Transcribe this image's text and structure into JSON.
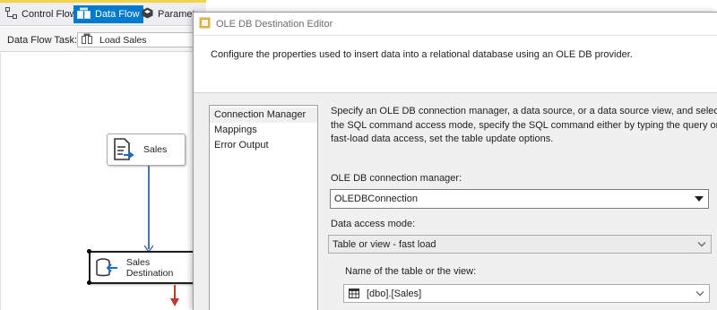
{
  "designer": {
    "tabs": [
      {
        "label": "Control Flow"
      },
      {
        "label": "Data Flow"
      },
      {
        "label": "Paramete"
      }
    ],
    "task_label": "Data Flow Task:",
    "task_value": "Load Sales",
    "components": [
      {
        "label": "Sales"
      },
      {
        "label": "Sales Destination"
      }
    ]
  },
  "dialog": {
    "title": "OLE DB Destination Editor",
    "description": "Configure the properties used to insert data into a relational database using an OLE DB provider.",
    "nav_items": [
      {
        "label": "Connection Manager"
      },
      {
        "label": "Mappings"
      },
      {
        "label": "Error Output"
      }
    ],
    "info_lines": [
      "Specify an OLE DB connection manager, a data source, or a data source view, and select the dat",
      "the SQL command access mode, specify the SQL command either by typing the query or by us",
      "fast-load data access, set the table update options."
    ],
    "connection_label": "OLE DB connection manager:",
    "connection_value": "OLEDBConnection",
    "access_mode_label": "Data access mode:",
    "access_mode_value": "Table or view - fast load",
    "table_label": "Name of the table or the view:",
    "table_value": "[dbo].[Sales]"
  },
  "colors": {
    "accent": "#007acc",
    "flow_line": "#4f6fa8",
    "error_arrow": "#c0392b"
  },
  "icons": [
    "control-flow-icon",
    "data-flow-icon",
    "parameters-icon",
    "package-icon",
    "source-component-icon",
    "destination-component-icon",
    "dialog-app-icon",
    "table-grid-icon",
    "chevron-down-icon"
  ]
}
